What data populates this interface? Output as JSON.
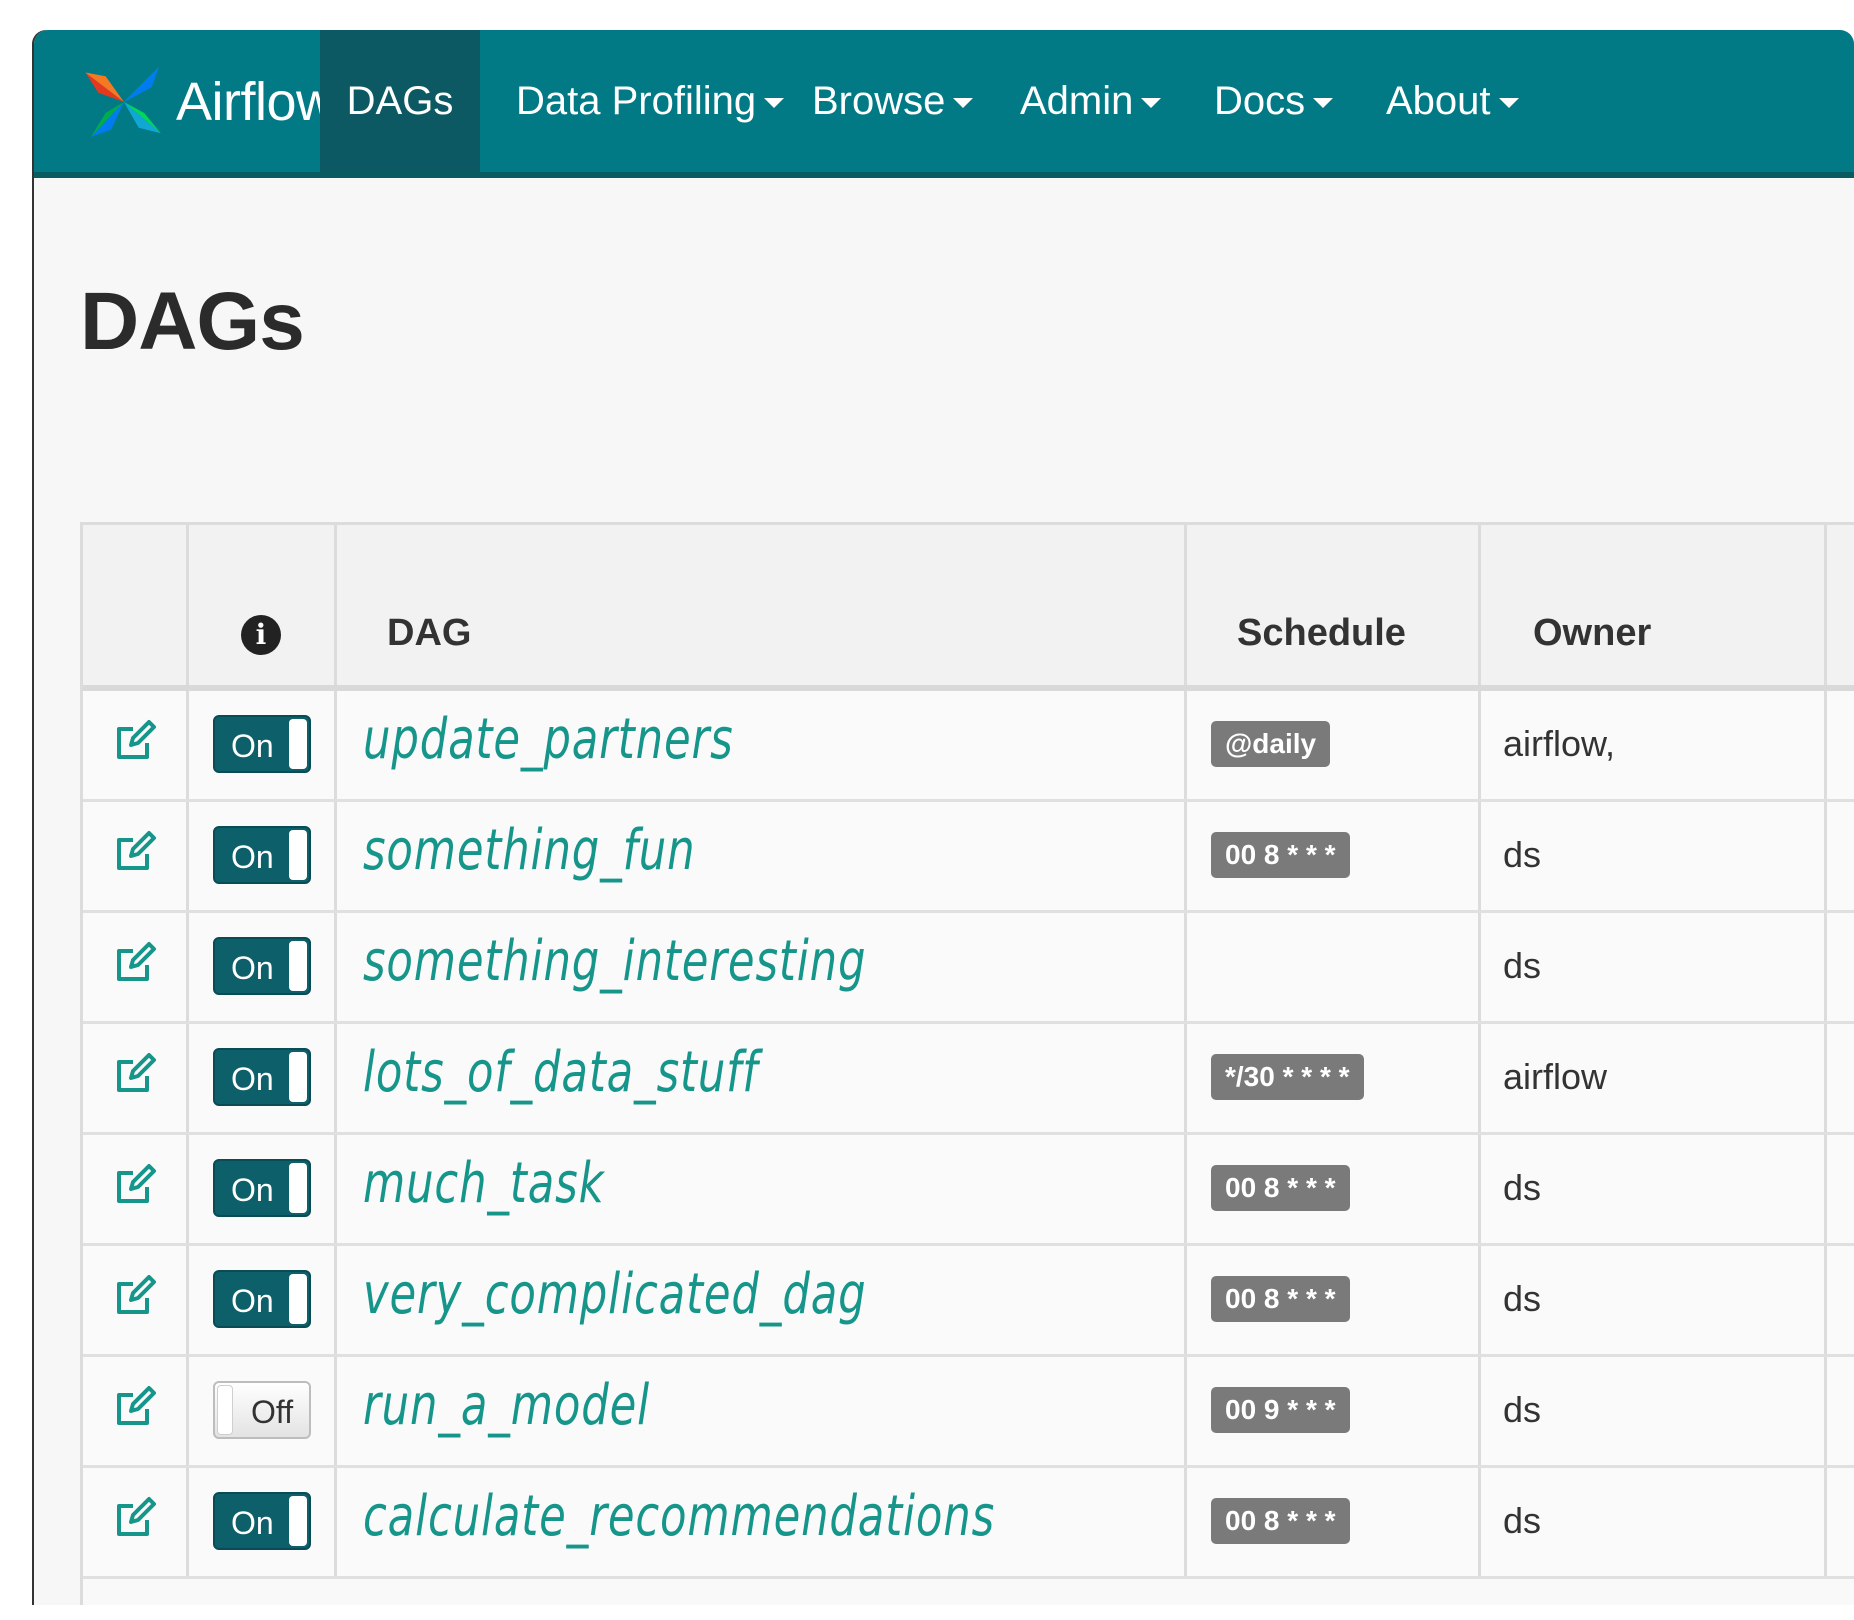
{
  "navbar": {
    "brand": "Airflow",
    "items": [
      {
        "label": "DAGs",
        "active": true,
        "dropdown": false
      },
      {
        "label": "Data Profiling",
        "active": false,
        "dropdown": true
      },
      {
        "label": "Browse",
        "active": false,
        "dropdown": true
      },
      {
        "label": "Admin",
        "active": false,
        "dropdown": true
      },
      {
        "label": "Docs",
        "active": false,
        "dropdown": true
      },
      {
        "label": "About",
        "active": false,
        "dropdown": true
      }
    ]
  },
  "page": {
    "title": "DAGs"
  },
  "table": {
    "headers": {
      "info_icon": "info-icon",
      "dag": "DAG",
      "schedule": "Schedule",
      "owner": "Owner"
    },
    "rows": [
      {
        "toggle": "On",
        "dag": "update_partners",
        "schedule": "@daily",
        "owner": "airflow,"
      },
      {
        "toggle": "On",
        "dag": "something_fun",
        "schedule": "00 8 * * *",
        "owner": "ds"
      },
      {
        "toggle": "On",
        "dag": "something_interesting",
        "schedule": "",
        "owner": "ds"
      },
      {
        "toggle": "On",
        "dag": "lots_of_data_stuff",
        "schedule": "*/30 * * * *",
        "owner": "airflow"
      },
      {
        "toggle": "On",
        "dag": "much_task",
        "schedule": "00 8 * * *",
        "owner": "ds"
      },
      {
        "toggle": "On",
        "dag": "very_complicated_dag",
        "schedule": "00 8 * * *",
        "owner": "ds"
      },
      {
        "toggle": "Off",
        "dag": "run_a_model",
        "schedule": "00 9 * * *",
        "owner": "ds"
      },
      {
        "toggle": "On",
        "dag": "calculate_recommendations",
        "schedule": "00 8 * * *",
        "owner": "ds"
      }
    ]
  },
  "colors": {
    "navbar": "#017a86",
    "navbar_active": "#0c5963",
    "toggle_on": "#0d5f6a",
    "dag_link": "#16958a",
    "badge": "#7a7a7a"
  }
}
